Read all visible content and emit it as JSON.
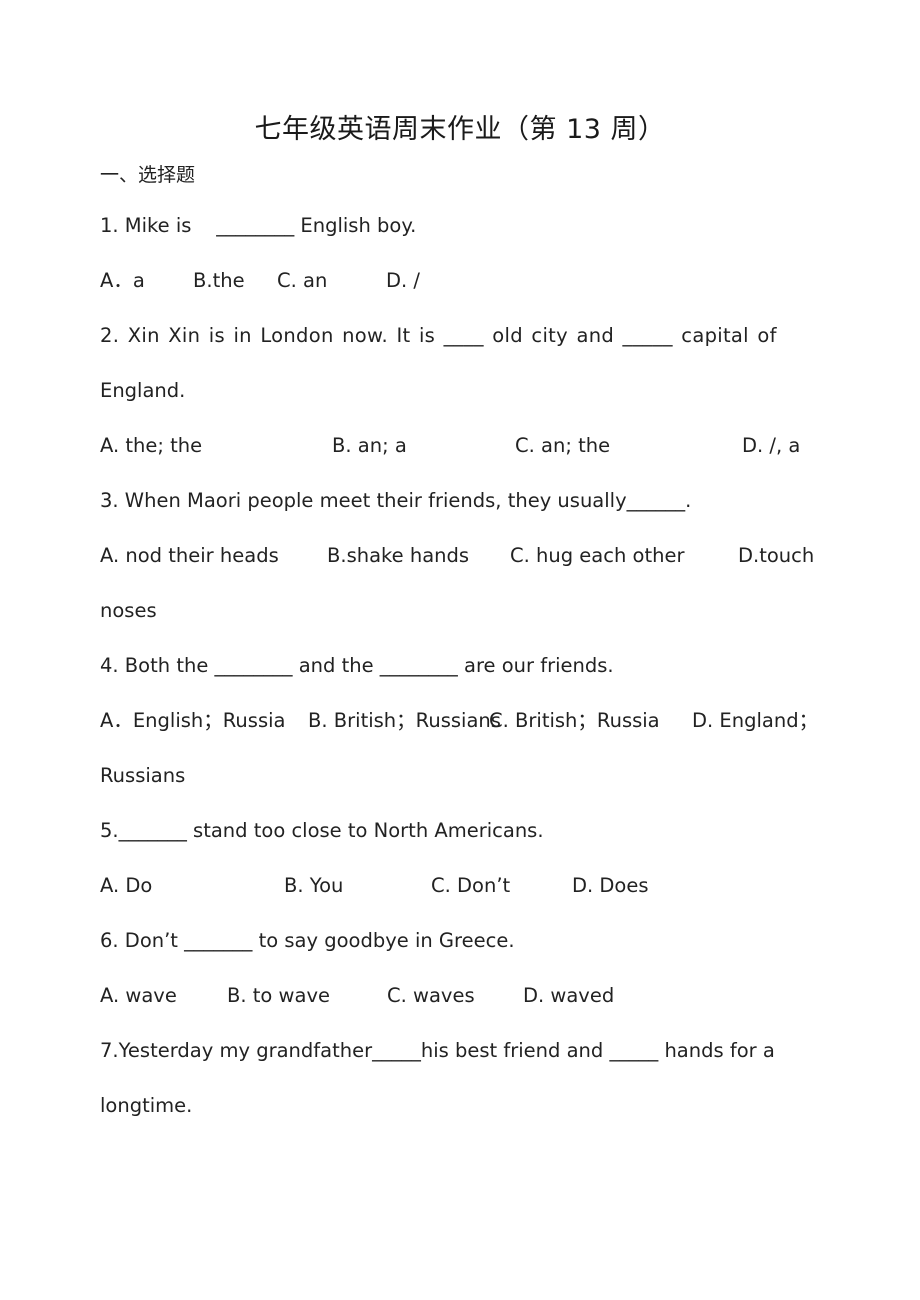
{
  "document": {
    "title": "七年级英语周末作业（第 13 周）",
    "section_heading": "一、选择题",
    "questions": [
      {
        "number": "1",
        "stem_line1": "1. Mike is    ________ English boy.",
        "options": [
          "A．a",
          "B.the",
          "C. an",
          "D. /"
        ]
      },
      {
        "number": "2",
        "stem_line1": "2. Xin Xin is in London now. It is ____ old city and _____ capital of",
        "stem_line2": "England.",
        "options": [
          "A. the; the",
          "B. an; a",
          "C. an; the",
          "D. /, a"
        ]
      },
      {
        "number": "3",
        "stem_line1": "3. When Maori people meet their friends, they usually______.",
        "options": [
          "A. nod their heads",
          "B.shake hands",
          "C. hug each other",
          "D.touch"
        ],
        "options_line2": "noses"
      },
      {
        "number": "4",
        "stem_line1": "4. Both the ________ and the ________ are our friends.",
        "options": [
          "A．English；Russia",
          "B. British；Russians",
          "C. British；Russia",
          "D. England；"
        ],
        "options_line2": "Russians"
      },
      {
        "number": "5",
        "stem_line1": "5._______ stand too close to North Americans.",
        "options": [
          "A. Do",
          "B. You",
          "C. Don’t",
          "D. Does"
        ]
      },
      {
        "number": "6",
        "stem_line1": "6. Don’t _______ to say goodbye in Greece.",
        "options": [
          "A. wave",
          "B. to wave",
          "C. waves",
          "D. waved"
        ]
      },
      {
        "number": "7",
        "stem_line1": "7.Yesterday my grandfather_____his best friend and _____ hands for a",
        "stem_line2": "longtime."
      }
    ]
  }
}
